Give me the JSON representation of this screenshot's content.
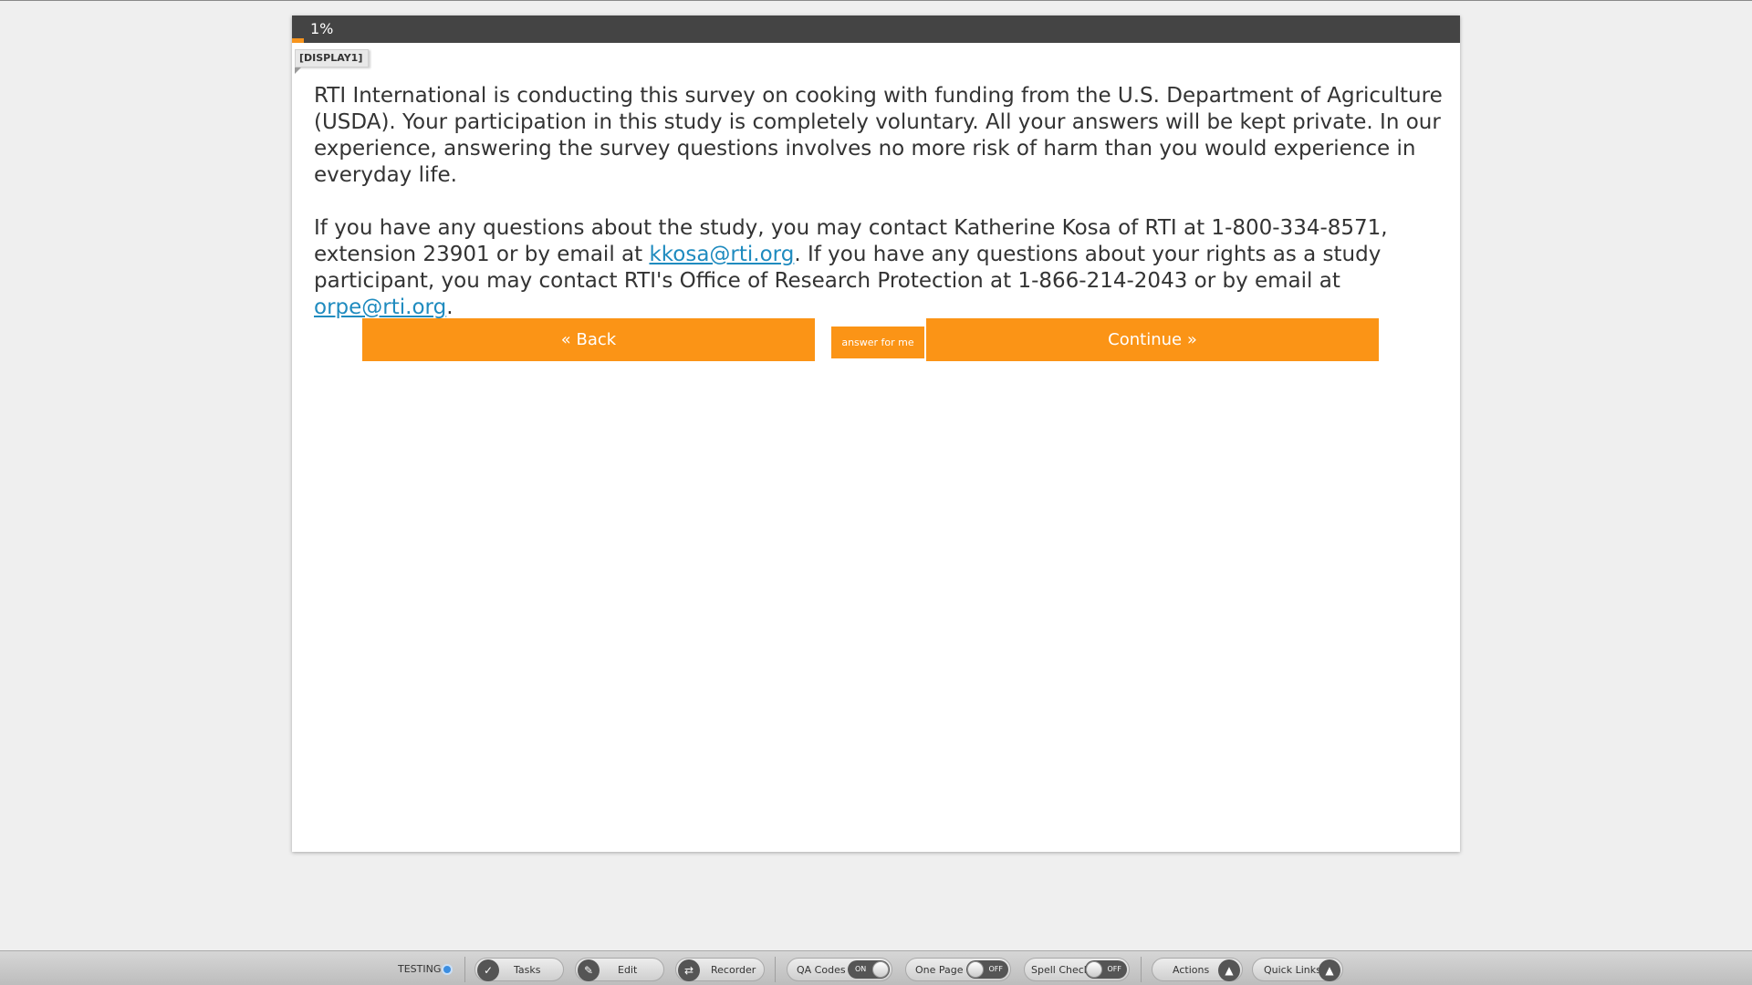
{
  "progress": {
    "percent_label": "1%",
    "fraction": 0.01
  },
  "question_label": "[DISPLAY1]",
  "content": {
    "para1": "RTI International is conducting this survey on cooking with funding from the U.S. Department of Agriculture (USDA). Your participation in this study is completely voluntary. All your answers will be kept private. In our experience, answering the survey questions involves no more risk of harm than you would experience in everyday life.",
    "para2_a": "If you have any questions about the study, you may contact Katherine Kosa of RTI at 1-800-334-8571, extension 23901 or by email at ",
    "para2_link1": "kkosa@rti.org",
    "para2_b": ". If you have any questions about your rights as a study participant, you may contact RTI's Office of Research Protection at 1-866-214-2043 or by email at ",
    "para2_link2": "orpe@rti.org",
    "para2_c": "."
  },
  "buttons": {
    "back": "« Back",
    "answer_for_me": "answer for me",
    "continue": "Continue »"
  },
  "toolbar": {
    "testing": "TESTING",
    "tasks": "Tasks",
    "edit": "Edit",
    "recorder": "Recorder",
    "qa_codes": "QA Codes",
    "qa_codes_state": "ON",
    "one_page": "One Page",
    "one_page_state": "OFF",
    "spell_check": "Spell Check",
    "spell_check_state": "OFF",
    "actions": "Actions",
    "quick_links": "Quick Links"
  },
  "colors": {
    "accent": "#fb9416",
    "progress_bar": "#444444",
    "link": "#1f8bbf",
    "testing_dot": "#3b8de0"
  },
  "icons": {
    "tasks": "check-icon",
    "edit": "pencil-icon",
    "recorder": "recorder-icon",
    "actions": "triangle-up-icon",
    "quick_links": "triangle-up-icon"
  }
}
